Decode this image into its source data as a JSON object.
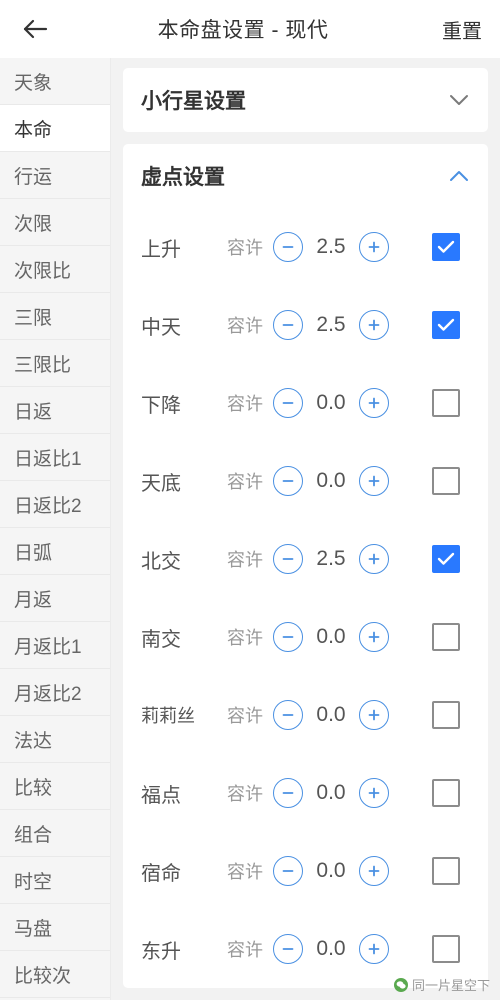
{
  "header": {
    "back_icon": "arrow-left-icon",
    "title": "本命盘设置 - 现代",
    "reset_label": "重置"
  },
  "sidebar": {
    "items": [
      {
        "label": "天象",
        "active": false
      },
      {
        "label": "本命",
        "active": true
      },
      {
        "label": "行运",
        "active": false
      },
      {
        "label": "次限",
        "active": false
      },
      {
        "label": "次限比",
        "active": false
      },
      {
        "label": "三限",
        "active": false
      },
      {
        "label": "三限比",
        "active": false
      },
      {
        "label": "日返",
        "active": false
      },
      {
        "label": "日返比1",
        "active": false
      },
      {
        "label": "日返比2",
        "active": false
      },
      {
        "label": "日弧",
        "active": false
      },
      {
        "label": "月返",
        "active": false
      },
      {
        "label": "月返比1",
        "active": false
      },
      {
        "label": "月返比2",
        "active": false
      },
      {
        "label": "法达",
        "active": false
      },
      {
        "label": "比较",
        "active": false
      },
      {
        "label": "组合",
        "active": false
      },
      {
        "label": "时空",
        "active": false
      },
      {
        "label": "马盘",
        "active": false
      },
      {
        "label": "比较次",
        "active": false
      }
    ]
  },
  "sections": [
    {
      "title": "小行星设置",
      "expanded": false,
      "chevron": "chevron-down-icon",
      "rows": []
    },
    {
      "title": "虚点设置",
      "expanded": true,
      "chevron": "chevron-up-icon",
      "rows": [
        {
          "name": "上升",
          "orb_label": "容许",
          "value": "2.5",
          "checked": true
        },
        {
          "name": "中天",
          "orb_label": "容许",
          "value": "2.5",
          "checked": true
        },
        {
          "name": "下降",
          "orb_label": "容许",
          "value": "0.0",
          "checked": false
        },
        {
          "name": "天底",
          "orb_label": "容许",
          "value": "0.0",
          "checked": false
        },
        {
          "name": "北交",
          "orb_label": "容许",
          "value": "2.5",
          "checked": true
        },
        {
          "name": "南交",
          "orb_label": "容许",
          "value": "0.0",
          "checked": false
        },
        {
          "name": "莉莉丝",
          "orb_label": "容许",
          "value": "0.0",
          "checked": false
        },
        {
          "name": "福点",
          "orb_label": "容许",
          "value": "0.0",
          "checked": false
        },
        {
          "name": "宿命",
          "orb_label": "容许",
          "value": "0.0",
          "checked": false
        },
        {
          "name": "东升",
          "orb_label": "容许",
          "value": "0.0",
          "checked": false
        }
      ]
    }
  ],
  "watermark": {
    "text": "同一片星空下",
    "icon": "wechat-icon"
  },
  "colors": {
    "accent": "#4a90e2",
    "checkbox_checked": "#2979ff",
    "sidebar_bg": "#f5f5f5",
    "page_bg": "#f2f2f2"
  }
}
